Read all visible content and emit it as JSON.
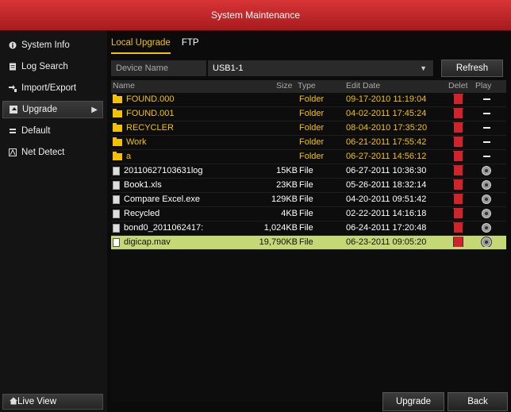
{
  "window": {
    "title": "System Maintenance"
  },
  "sidebar": {
    "items": [
      {
        "label": "System Info",
        "icon": "info-icon"
      },
      {
        "label": "Log Search",
        "icon": "log-icon"
      },
      {
        "label": "Import/Export",
        "icon": "import-export-icon"
      },
      {
        "label": "Upgrade",
        "icon": "upgrade-icon",
        "active": true
      },
      {
        "label": "Default",
        "icon": "default-icon"
      },
      {
        "label": "Net Detect",
        "icon": "net-detect-icon"
      }
    ],
    "live_view": "Live View"
  },
  "tabs": [
    {
      "label": "Local Upgrade",
      "active": true
    },
    {
      "label": "FTP",
      "active": false
    }
  ],
  "device": {
    "label": "Device Name",
    "value": "USB1-1",
    "refresh_label": "Refresh"
  },
  "table": {
    "headers": {
      "name": "Name",
      "size": "Size",
      "type": "Type",
      "date": "Edit Date",
      "delete": "Delet",
      "play": "Play"
    },
    "rows": [
      {
        "name": "FOUND.000",
        "size": "",
        "type": "Folder",
        "date": "09-17-2010 11:19:04",
        "kind": "folder"
      },
      {
        "name": "FOUND.001",
        "size": "",
        "type": "Folder",
        "date": "04-02-2011 17:45:24",
        "kind": "folder"
      },
      {
        "name": "RECYCLER",
        "size": "",
        "type": "Folder",
        "date": "08-04-2010 17:35:20",
        "kind": "folder"
      },
      {
        "name": "Work",
        "size": "",
        "type": "Folder",
        "date": "06-21-2011 17:55:42",
        "kind": "folder"
      },
      {
        "name": "a",
        "size": "",
        "type": "Folder",
        "date": "06-27-2011 14:56:12",
        "kind": "folder"
      },
      {
        "name": "20110627103631log",
        "size": "15KB",
        "type": "File",
        "date": "06-27-2011 10:36:30",
        "kind": "file"
      },
      {
        "name": "Book1.xls",
        "size": "23KB",
        "type": "File",
        "date": "05-26-2011 18:32:14",
        "kind": "file"
      },
      {
        "name": "Compare Excel.exe",
        "size": "129KB",
        "type": "File",
        "date": "04-20-2011 09:51:42",
        "kind": "file"
      },
      {
        "name": "Recycled",
        "size": "4KB",
        "type": "File",
        "date": "02-22-2011 14:16:18",
        "kind": "file"
      },
      {
        "name": "bond0_2011062417:",
        "size": "1,024KB",
        "type": "File",
        "date": "06-24-2011 17:20:48",
        "kind": "file"
      },
      {
        "name": "digicap.mav",
        "size": "19,790KB",
        "type": "File",
        "date": "06-23-2011 09:05:20",
        "kind": "file",
        "selected": true
      }
    ]
  },
  "actions": {
    "upgrade_label": "Upgrade",
    "back_label": "Back"
  },
  "colors": {
    "title_red": "#c82628",
    "folder_yellow": "#f2c200",
    "selected_row": "#c6d875",
    "delete_red": "#d2232a"
  }
}
